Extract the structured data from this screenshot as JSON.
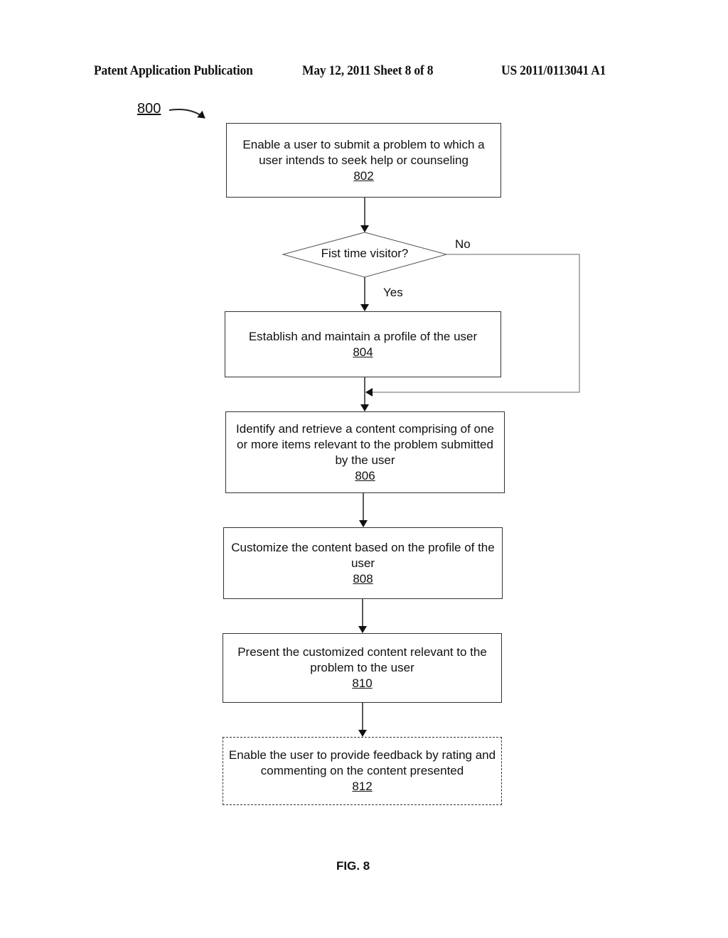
{
  "header": {
    "publication": "Patent Application Publication",
    "date_sheet": "May 12, 2011   Sheet 8 of 8",
    "number": "US 2011/0113041 A1"
  },
  "figure": {
    "ref": "800",
    "caption": "FIG. 8"
  },
  "steps": [
    {
      "id": "802",
      "text": "Enable a user to submit a problem to which a user intends to seek help or counseling",
      "style": "solid"
    },
    {
      "id": "804",
      "text": "Establish and maintain a profile of the user",
      "style": "solid"
    },
    {
      "id": "806",
      "text": "Identify and retrieve a content comprising of one or more items relevant to the problem submitted by the user",
      "style": "solid"
    },
    {
      "id": "808",
      "text": "Customize the content based on the profile of the user",
      "style": "solid"
    },
    {
      "id": "810",
      "text": "Present the customized content relevant to the problem to the user",
      "style": "solid"
    },
    {
      "id": "812",
      "text": "Enable the user to provide feedback by rating and commenting on the content presented",
      "style": "dashed"
    }
  ],
  "decision": {
    "text": "Fist time visitor?",
    "yes_label": "Yes",
    "no_label": "No"
  }
}
